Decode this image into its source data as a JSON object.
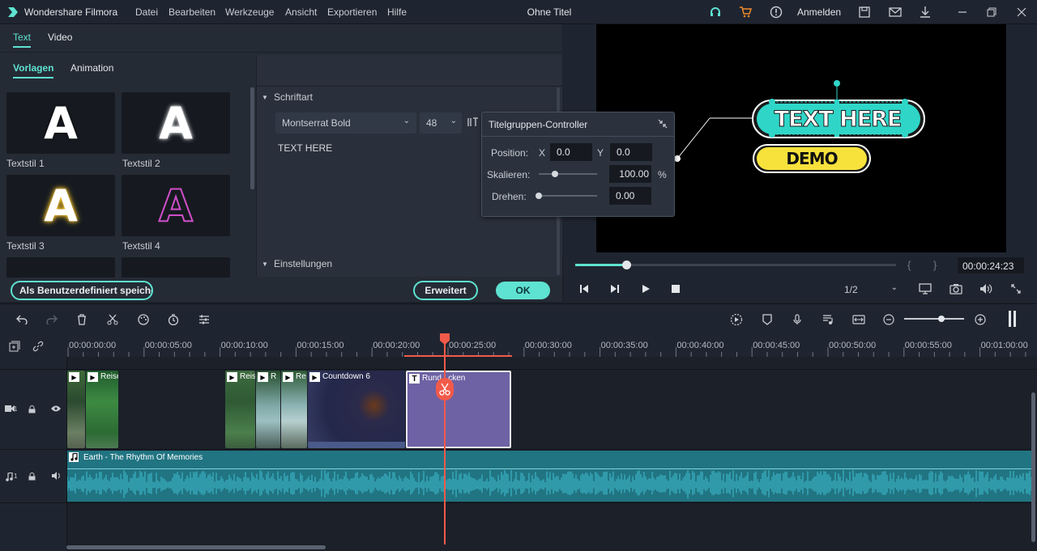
{
  "app": {
    "name": "Wondershare Filmora",
    "document_title": "Ohne Titel",
    "menu": [
      "Datei",
      "Bearbeiten",
      "Werkzeuge",
      "Ansicht",
      "Exportieren",
      "Hilfe"
    ],
    "login_label": "Anmelden"
  },
  "left_panel": {
    "tabs": [
      "Text",
      "Video"
    ],
    "subtabs": [
      "Vorlagen",
      "Animation"
    ],
    "presets": [
      {
        "label": "Textstil 1",
        "glyph": "A"
      },
      {
        "label": "Textstil 2",
        "glyph": "A"
      },
      {
        "label": "Textstil 3",
        "glyph": "A"
      },
      {
        "label": "Textstil 4",
        "glyph": "A"
      }
    ],
    "font_section": "Schriftart",
    "font_name": "Montserrat Bold",
    "font_size": "48",
    "text_content": "TEXT HERE",
    "settings_section": "Einstellungen",
    "save_custom_label": "Als Benutzerdefiniert speichern",
    "advanced_label": "Erweitert",
    "ok_label": "OK"
  },
  "controller": {
    "title": "Titelgruppen-Controller",
    "position_label": "Position:",
    "x_label": "X",
    "x_value": "0.0",
    "y_label": "Y",
    "y_value": "0.0",
    "scale_label": "Skalieren:",
    "scale_value": "100.00",
    "scale_unit": "%",
    "rotate_label": "Drehen:",
    "rotate_value": "0.00",
    "scale_slider_fraction": 0.28,
    "rotate_slider_fraction": 0.0
  },
  "preview": {
    "main_text": "TEXT HERE",
    "sub_text": "DEMO",
    "accent_teal": "#2fd6c8",
    "accent_yellow": "#f7e23c"
  },
  "player": {
    "progress_fraction": 0.16,
    "timecode": "00:00:24:23",
    "quality": "1/2",
    "bracket_in": "{",
    "bracket_out": "}"
  },
  "timeline": {
    "ticks": [
      "00:00:00:00",
      "00:00:05:00",
      "00:00:10:00",
      "00:00:15:00",
      "00:00:20:00",
      "00:00:25:00",
      "00:00:30:00",
      "00:00:35:00",
      "00:00:40:00",
      "00:00:45:00",
      "00:00:50:00",
      "00:00:55:00",
      "00:01:00:00"
    ],
    "video_track_label": "1",
    "audio_track_label": "1",
    "clips": [
      {
        "title": "Reise"
      },
      {
        "title": "Reise"
      },
      {
        "title": "R"
      },
      {
        "title": "Re"
      },
      {
        "title": "Countdown 6"
      },
      {
        "title": "Rund...cken"
      }
    ],
    "audio_clip_title": "Earth - The Rhythm Of Memories"
  },
  "colors": {
    "accent": "#5ee2d1",
    "playhead": "#f25a4a"
  }
}
